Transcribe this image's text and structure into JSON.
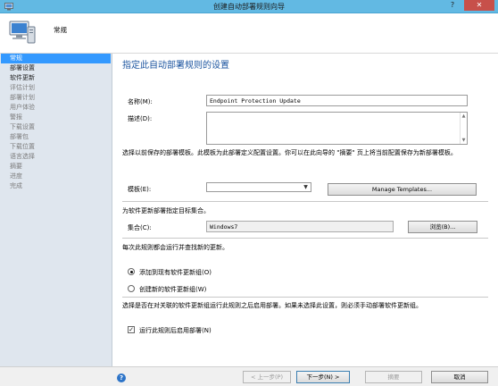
{
  "window": {
    "title": "创建自动部署规则向导",
    "help_glyph": "?",
    "close_glyph": "✕"
  },
  "header": {
    "section": "常规"
  },
  "sidebar": {
    "items": [
      {
        "label": "常规",
        "state": "active"
      },
      {
        "label": "部署设置",
        "state": "normal"
      },
      {
        "label": "软件更新",
        "state": "normal"
      },
      {
        "label": "评估计划",
        "state": "dim"
      },
      {
        "label": "部署计划",
        "state": "dim"
      },
      {
        "label": "用户体验",
        "state": "dim"
      },
      {
        "label": "警报",
        "state": "dim"
      },
      {
        "label": "下载设置",
        "state": "dim"
      },
      {
        "label": "部署包",
        "state": "dim"
      },
      {
        "label": "下载位置",
        "state": "dim"
      },
      {
        "label": "语言选择",
        "state": "dim"
      },
      {
        "label": "摘要",
        "state": "dim"
      },
      {
        "label": "进度",
        "state": "dim"
      },
      {
        "label": "完成",
        "state": "dim"
      }
    ]
  },
  "main": {
    "page_title": "指定此自动部署规则的设置",
    "name_label": "名称(M):",
    "name_value": "Endpoint Protection Update",
    "description_label": "描述(D):",
    "description_value": "",
    "template_hint": "选择以前保存的部署模板。此模板为此部署定义配置设置。你可以在此向导的 \"摘要\" 页上将当前配置保存为新部署模板。",
    "template_label": "模板(E):",
    "template_value": "",
    "manage_templates_button": "Manage Templates...",
    "target_hint": "为软件更新部署指定目标集合。",
    "collection_label": "集合(C):",
    "collection_value": "Windows7",
    "browse_button": "浏览(B)...",
    "rule_run_hint": "每次此规则都会运行并查找新的更新。",
    "radio_add_existing": "添加到现有软件更新组(O)",
    "radio_create_new": "创建新的软件更新组(W)",
    "enable_hint": "选择是否在对关联的软件更新组运行此规则之后启用部署。如果未选择此设置，则必须手动部署软件更新组。",
    "enable_checkbox_label": "运行此规则后启用部署(N)",
    "enable_checkbox_checked": true,
    "radio_selected": "add_existing"
  },
  "footer": {
    "help_glyph": "?",
    "prev_button": "< 上一步(P)",
    "next_button": "下一步(N) >",
    "summary_button": "摘要",
    "cancel_button": "取消"
  }
}
